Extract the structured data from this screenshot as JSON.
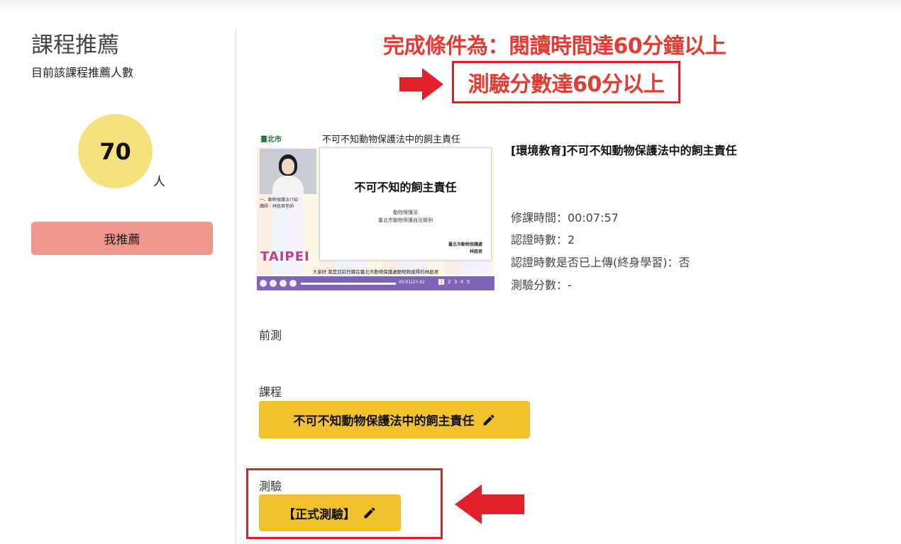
{
  "sidebar": {
    "title": "課程推薦",
    "subtitle": "目前該課程推薦人數",
    "count": "70",
    "count_unit": "人",
    "recommend_button": "我推薦"
  },
  "annotation": {
    "line1": "完成條件為：閱讀時間達60分鐘以上",
    "line2": "測驗分數達60分以上",
    "color": "#e33a31"
  },
  "thumbnail": {
    "logo": "臺北市",
    "header": "不可不知動物保護法中的飼主責任",
    "slide_title": "不可不知的飼主責任",
    "slide_sub1": "動物保護法",
    "slide_sub2": "臺北市動物保護自治條例",
    "slide_foot1": "臺北市動物保護處",
    "slide_foot2": "林庭君",
    "left_caption1": "一、動物保護法介紹",
    "left_caption2": "講師｜林庭君老師",
    "brand": "TAIPEI",
    "subtitle": "大家好 我是目前任職在臺北市動物保護處動物救援隊的林庭君",
    "time": "00:01/27:42",
    "pages": [
      "1",
      "2",
      "3",
      "4",
      "5"
    ]
  },
  "course": {
    "name": "[環境教育]不可不知動物保護法中的飼主責任",
    "study_time": "修課時間：00:07:57",
    "cert_hours": "認證時數：2",
    "uploaded": "認證時數是否已上傳(終身學習)：否",
    "score": "測驗分數：-"
  },
  "sections": {
    "pretest_label": "前測",
    "course_label": "課程",
    "course_button": "不可不知動物保護法中的飼主責任",
    "quiz_label": "測驗",
    "quiz_button": "【正式測驗】"
  },
  "colors": {
    "accent_yellow": "#f2c12e",
    "recommend_pink": "#f1978c",
    "count_circle": "#f5e27e",
    "annotation_red": "#e0202a"
  }
}
